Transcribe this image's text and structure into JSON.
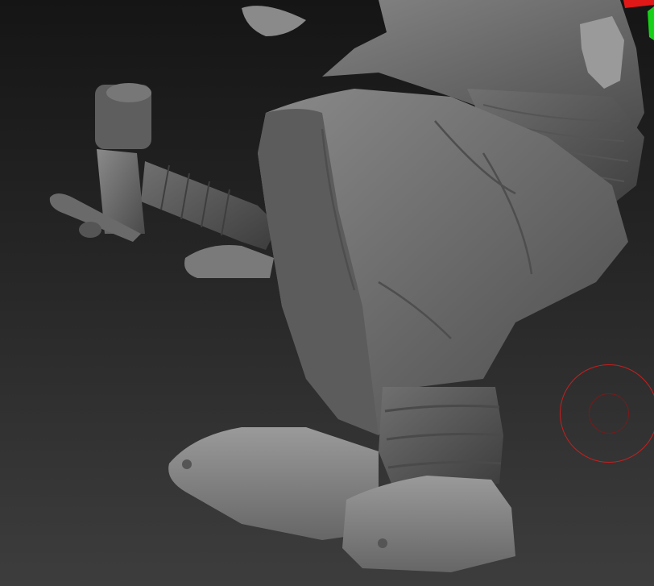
{
  "viewport": {
    "background_top": "#151515",
    "background_bottom": "#3d3d3d",
    "model_color": "#6e6e6e"
  },
  "brush_cursor": {
    "outer_color": "#c81e1e",
    "inner_color": "#7a1a1a"
  },
  "axis_gizmo": {
    "x_color": "#e01818",
    "y_color": "#18d018"
  }
}
